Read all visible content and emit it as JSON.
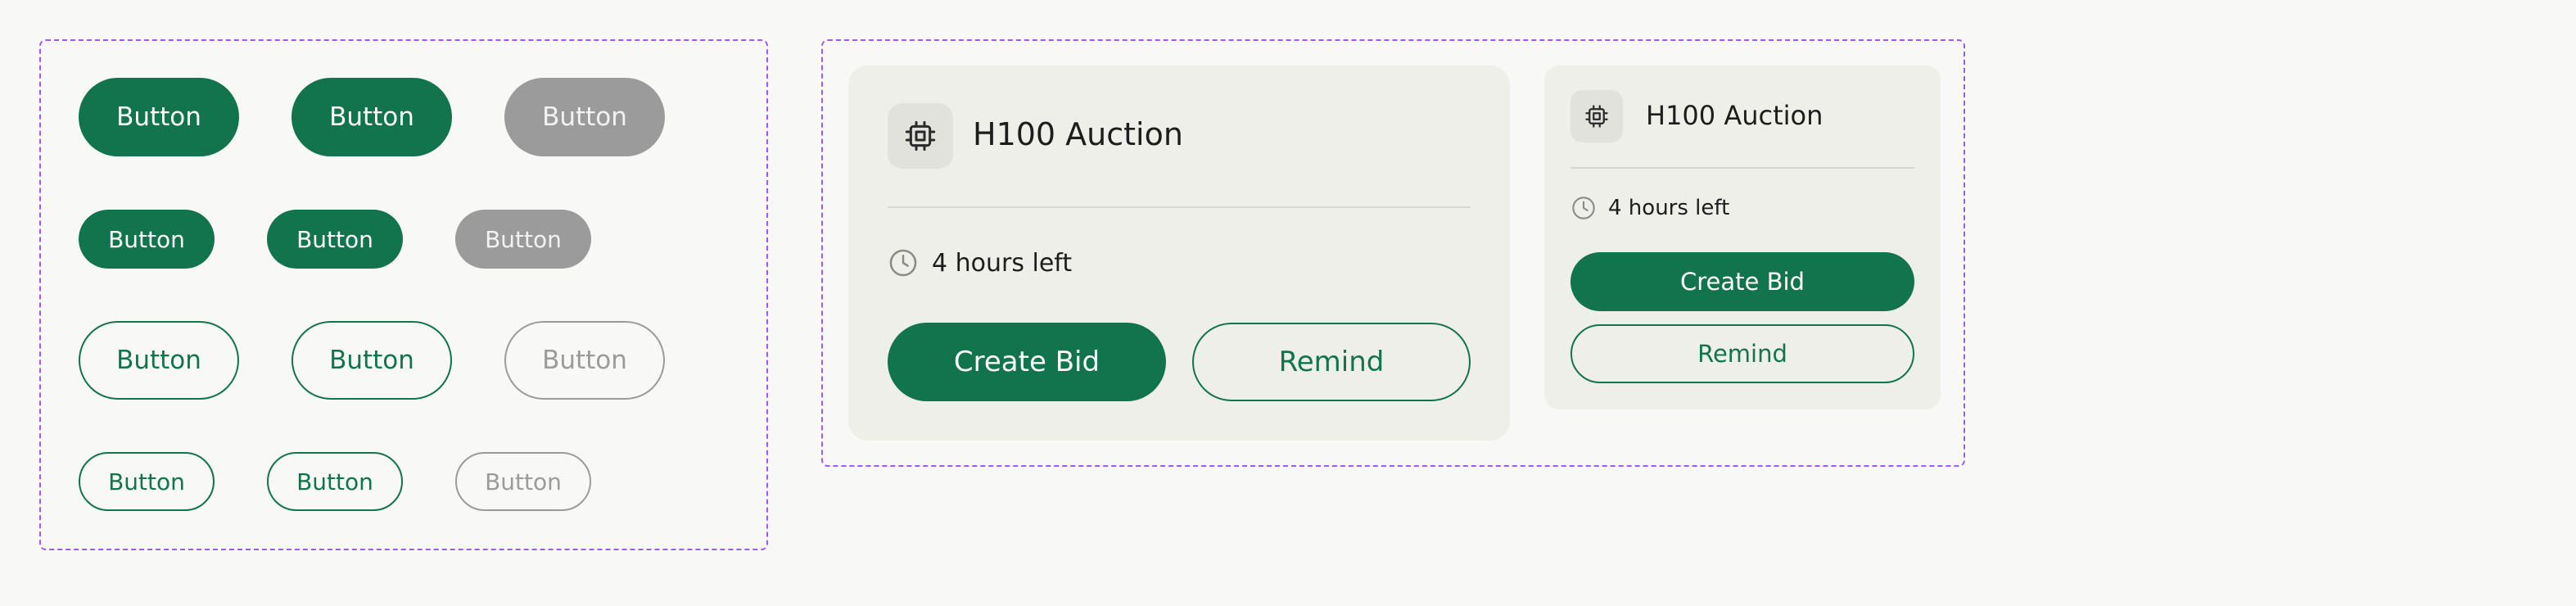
{
  "button_label": "Button",
  "auction": {
    "title": "H100 Auction",
    "time_left": "4 hours left",
    "create_bid_label": "Create Bid",
    "remind_label": "Remind"
  },
  "colors": {
    "primary": "#12744c",
    "disabled": "#9b9b9b",
    "card_background": "#efefea",
    "frame_border": "#9a5cf0",
    "page_background": "#f8f8f6"
  },
  "icons": {
    "chip": "cpu-chip-icon",
    "clock": "clock-icon"
  }
}
